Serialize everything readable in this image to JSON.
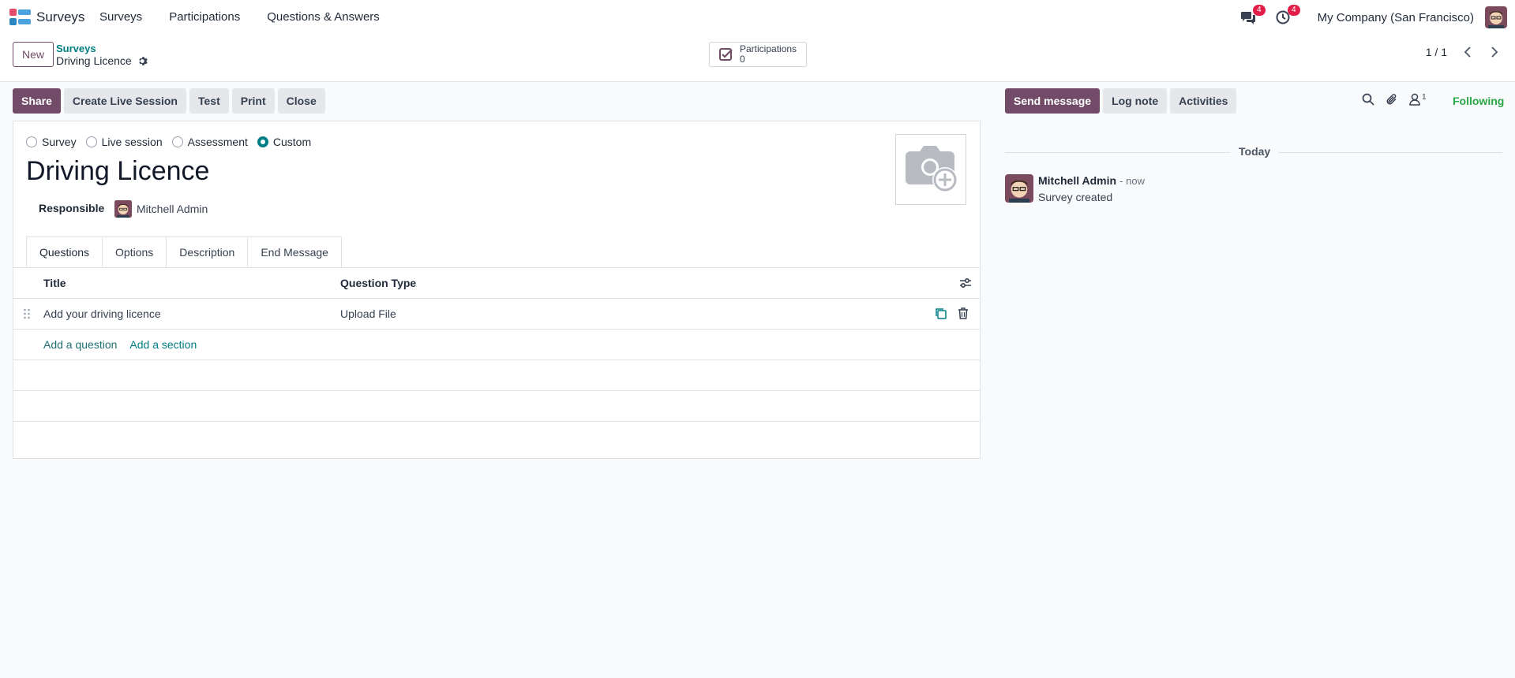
{
  "app": {
    "name": "Surveys",
    "menu": [
      "Surveys",
      "Participations",
      "Questions & Answers"
    ],
    "messages_badge": "4",
    "activities_badge": "4",
    "company": "My Company (San Francisco)"
  },
  "control": {
    "new_label": "New",
    "breadcrumb_parent": "Surveys",
    "breadcrumb_current": "Driving Licence",
    "stat_label": "Participations",
    "stat_value": "0",
    "pager": "1 / 1"
  },
  "actions": {
    "share": "Share",
    "live_session": "Create Live Session",
    "test": "Test",
    "print": "Print",
    "close": "Close"
  },
  "form": {
    "survey_types": [
      {
        "label": "Survey",
        "checked": false
      },
      {
        "label": "Live session",
        "checked": false
      },
      {
        "label": "Assessment",
        "checked": false
      },
      {
        "label": "Custom",
        "checked": true
      }
    ],
    "title": "Driving Licence",
    "responsible_label": "Responsible",
    "responsible_value": "Mitchell Admin",
    "tabs": [
      "Questions",
      "Options",
      "Description",
      "End Message"
    ],
    "active_tab": "Questions",
    "columns": [
      "Title",
      "Question Type"
    ],
    "rows": [
      {
        "title": "Add your driving licence",
        "type": "Upload File"
      }
    ],
    "add_question": "Add a question",
    "add_section": "Add a section"
  },
  "chatter": {
    "send_message": "Send message",
    "log_note": "Log note",
    "activities": "Activities",
    "followers_count": "1",
    "following": "Following",
    "date_separator": "Today",
    "messages": [
      {
        "author": "Mitchell Admin",
        "time": "- now",
        "body": "Survey created"
      }
    ]
  },
  "colors": {
    "brand": "#714B67",
    "accent": "#017e84",
    "following": "#28a745",
    "badge": "#e11d48"
  }
}
